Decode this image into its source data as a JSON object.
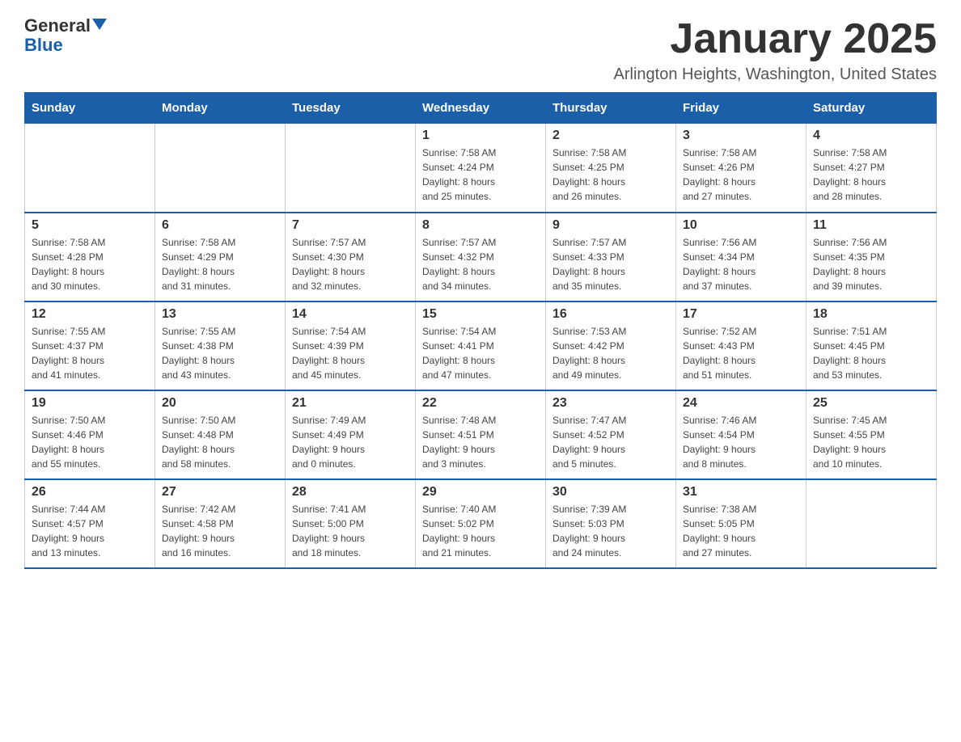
{
  "logo": {
    "line1": "General",
    "line2": "Blue"
  },
  "title": "January 2025",
  "subtitle": "Arlington Heights, Washington, United States",
  "days_of_week": [
    "Sunday",
    "Monday",
    "Tuesday",
    "Wednesday",
    "Thursday",
    "Friday",
    "Saturday"
  ],
  "weeks": [
    [
      {
        "day": "",
        "info": ""
      },
      {
        "day": "",
        "info": ""
      },
      {
        "day": "",
        "info": ""
      },
      {
        "day": "1",
        "info": "Sunrise: 7:58 AM\nSunset: 4:24 PM\nDaylight: 8 hours\nand 25 minutes."
      },
      {
        "day": "2",
        "info": "Sunrise: 7:58 AM\nSunset: 4:25 PM\nDaylight: 8 hours\nand 26 minutes."
      },
      {
        "day": "3",
        "info": "Sunrise: 7:58 AM\nSunset: 4:26 PM\nDaylight: 8 hours\nand 27 minutes."
      },
      {
        "day": "4",
        "info": "Sunrise: 7:58 AM\nSunset: 4:27 PM\nDaylight: 8 hours\nand 28 minutes."
      }
    ],
    [
      {
        "day": "5",
        "info": "Sunrise: 7:58 AM\nSunset: 4:28 PM\nDaylight: 8 hours\nand 30 minutes."
      },
      {
        "day": "6",
        "info": "Sunrise: 7:58 AM\nSunset: 4:29 PM\nDaylight: 8 hours\nand 31 minutes."
      },
      {
        "day": "7",
        "info": "Sunrise: 7:57 AM\nSunset: 4:30 PM\nDaylight: 8 hours\nand 32 minutes."
      },
      {
        "day": "8",
        "info": "Sunrise: 7:57 AM\nSunset: 4:32 PM\nDaylight: 8 hours\nand 34 minutes."
      },
      {
        "day": "9",
        "info": "Sunrise: 7:57 AM\nSunset: 4:33 PM\nDaylight: 8 hours\nand 35 minutes."
      },
      {
        "day": "10",
        "info": "Sunrise: 7:56 AM\nSunset: 4:34 PM\nDaylight: 8 hours\nand 37 minutes."
      },
      {
        "day": "11",
        "info": "Sunrise: 7:56 AM\nSunset: 4:35 PM\nDaylight: 8 hours\nand 39 minutes."
      }
    ],
    [
      {
        "day": "12",
        "info": "Sunrise: 7:55 AM\nSunset: 4:37 PM\nDaylight: 8 hours\nand 41 minutes."
      },
      {
        "day": "13",
        "info": "Sunrise: 7:55 AM\nSunset: 4:38 PM\nDaylight: 8 hours\nand 43 minutes."
      },
      {
        "day": "14",
        "info": "Sunrise: 7:54 AM\nSunset: 4:39 PM\nDaylight: 8 hours\nand 45 minutes."
      },
      {
        "day": "15",
        "info": "Sunrise: 7:54 AM\nSunset: 4:41 PM\nDaylight: 8 hours\nand 47 minutes."
      },
      {
        "day": "16",
        "info": "Sunrise: 7:53 AM\nSunset: 4:42 PM\nDaylight: 8 hours\nand 49 minutes."
      },
      {
        "day": "17",
        "info": "Sunrise: 7:52 AM\nSunset: 4:43 PM\nDaylight: 8 hours\nand 51 minutes."
      },
      {
        "day": "18",
        "info": "Sunrise: 7:51 AM\nSunset: 4:45 PM\nDaylight: 8 hours\nand 53 minutes."
      }
    ],
    [
      {
        "day": "19",
        "info": "Sunrise: 7:50 AM\nSunset: 4:46 PM\nDaylight: 8 hours\nand 55 minutes."
      },
      {
        "day": "20",
        "info": "Sunrise: 7:50 AM\nSunset: 4:48 PM\nDaylight: 8 hours\nand 58 minutes."
      },
      {
        "day": "21",
        "info": "Sunrise: 7:49 AM\nSunset: 4:49 PM\nDaylight: 9 hours\nand 0 minutes."
      },
      {
        "day": "22",
        "info": "Sunrise: 7:48 AM\nSunset: 4:51 PM\nDaylight: 9 hours\nand 3 minutes."
      },
      {
        "day": "23",
        "info": "Sunrise: 7:47 AM\nSunset: 4:52 PM\nDaylight: 9 hours\nand 5 minutes."
      },
      {
        "day": "24",
        "info": "Sunrise: 7:46 AM\nSunset: 4:54 PM\nDaylight: 9 hours\nand 8 minutes."
      },
      {
        "day": "25",
        "info": "Sunrise: 7:45 AM\nSunset: 4:55 PM\nDaylight: 9 hours\nand 10 minutes."
      }
    ],
    [
      {
        "day": "26",
        "info": "Sunrise: 7:44 AM\nSunset: 4:57 PM\nDaylight: 9 hours\nand 13 minutes."
      },
      {
        "day": "27",
        "info": "Sunrise: 7:42 AM\nSunset: 4:58 PM\nDaylight: 9 hours\nand 16 minutes."
      },
      {
        "day": "28",
        "info": "Sunrise: 7:41 AM\nSunset: 5:00 PM\nDaylight: 9 hours\nand 18 minutes."
      },
      {
        "day": "29",
        "info": "Sunrise: 7:40 AM\nSunset: 5:02 PM\nDaylight: 9 hours\nand 21 minutes."
      },
      {
        "day": "30",
        "info": "Sunrise: 7:39 AM\nSunset: 5:03 PM\nDaylight: 9 hours\nand 24 minutes."
      },
      {
        "day": "31",
        "info": "Sunrise: 7:38 AM\nSunset: 5:05 PM\nDaylight: 9 hours\nand 27 minutes."
      },
      {
        "day": "",
        "info": ""
      }
    ]
  ]
}
